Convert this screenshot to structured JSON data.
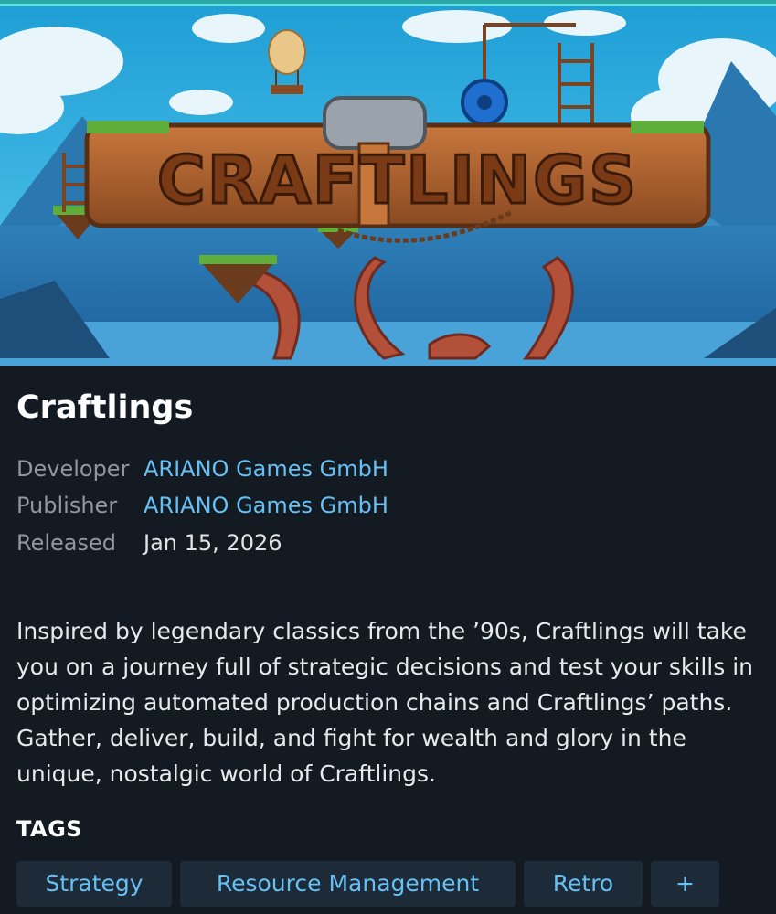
{
  "game": {
    "title": "Craftlings",
    "logo_text": "CRAFTLINGS"
  },
  "meta": {
    "developer_label": "Developer",
    "developer_value": "ARIANO Games GmbH",
    "publisher_label": "Publisher",
    "publisher_value": "ARIANO Games GmbH",
    "released_label": "Released",
    "released_value": "Jan 15, 2026"
  },
  "description": "Inspired by legendary classics from the ’90s, Craftlings will take you on a journey full of strategic decisions and test your skills in optimizing automated production chains and Craftlings’ paths. Gather, deliver, build, and fight for wealth and glory in the unique, nostalgic world of Craftlings.",
  "tags": {
    "heading": "TAGS",
    "items": [
      "Strategy",
      "Resource Management",
      "Retro"
    ],
    "more_label": "+"
  },
  "colors": {
    "background": "#131a22",
    "link": "#66c0f4",
    "label": "#8f98a0",
    "tag_bg": "#1d2a38",
    "accent_strip": "#2ca8a6"
  },
  "icons": [
    "plus-icon"
  ]
}
